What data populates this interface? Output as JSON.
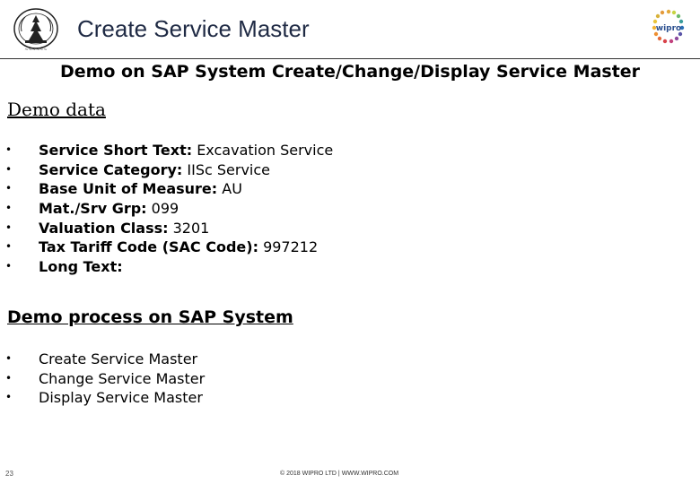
{
  "header": {
    "title": "Create Service Master",
    "left_logo": "institute-seal-logo",
    "right_logo": "wipro-logo"
  },
  "subtitle": "Demo on SAP System Create/Change/Display Service Master",
  "demo_data": {
    "heading": "Demo data",
    "items": [
      {
        "label": "Service Short Text:",
        "value": " Excavation Service"
      },
      {
        "label": "Service Category:",
        "value": " IISc Service"
      },
      {
        "label": "Base Unit of Measure:",
        "value": " AU"
      },
      {
        "label": "Mat./Srv Grp:",
        "value": " 099"
      },
      {
        "label": "Valuation Class:",
        "value": " 3201"
      },
      {
        "label": "Tax Tariff Code (SAC Code):",
        "value": " 997212"
      },
      {
        "label": "Long Text:",
        "value": ""
      }
    ]
  },
  "demo_process": {
    "heading": "Demo process on SAP System",
    "items": [
      "Create Service Master",
      "Change Service Master",
      "Display Service Master"
    ]
  },
  "footer": {
    "page_number": "23",
    "copyright": "© 2018 WIPRO LTD | WWW.WIPRO.COM"
  },
  "colors": {
    "title": "#1f2a44",
    "wipro_blue": "#2a6fb5"
  }
}
